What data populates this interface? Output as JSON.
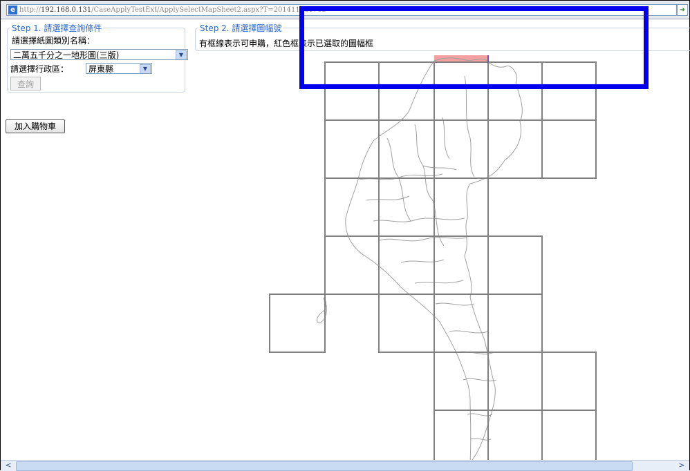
{
  "browser": {
    "address_prefix": "http://",
    "address_host": "192.168.0.131",
    "address_path": "/CaseApplyTestExt/ApplySelectMapSheet2.aspx?T=201411061703",
    "ie_icon": "e"
  },
  "step1": {
    "legend": "Step 1. 請選擇查詢條件",
    "sheet_type_label": "請選擇紙圖類別名稱：",
    "sheet_type_value": "二萬五千分之一地形圖(三版)",
    "district_label": "請選擇行政區：",
    "district_value": "屏東縣",
    "query_button": "查詢"
  },
  "cart_button": "加入購物車",
  "step2": {
    "legend": "Step 2. 請選擇圖幅號",
    "hint": "有框線表示可申購，紅色框表示已選取的圖幅框"
  },
  "map": {
    "selected_sheet_color": "#f4a0a0",
    "grid_color": "#808080",
    "outline_color": "#9a9a9a",
    "highlight_color": "#0000ee"
  },
  "icons": {
    "dropdown": "chevron-down-icon",
    "scroll_left": "scroll-left-icon",
    "scroll_right": "scroll-right-icon"
  }
}
